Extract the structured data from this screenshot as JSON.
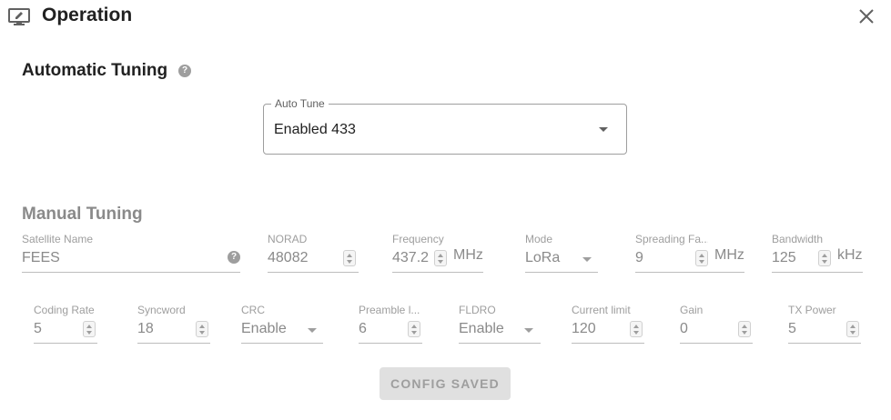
{
  "header": {
    "title": "Operation",
    "icon": "monitor-edit-icon",
    "close_icon": "close-icon"
  },
  "automatic": {
    "title": "Automatic Tuning",
    "help_icon": "help-icon",
    "auto_tune": {
      "label": "Auto Tune",
      "value": "Enabled 433"
    }
  },
  "manual": {
    "title": "Manual Tuning",
    "satellite_name": {
      "label": "Satellite Name",
      "value": "FEES"
    },
    "norad": {
      "label": "NORAD",
      "value": "48082"
    },
    "frequency": {
      "label": "Frequency",
      "value": "437.2",
      "unit": "MHz"
    },
    "mode": {
      "label": "Mode",
      "value": "LoRa"
    },
    "spreading_factor": {
      "label": "Spreading Fa...",
      "value": "9",
      "unit": "MHz"
    },
    "bandwidth": {
      "label": "Bandwidth",
      "value": "125",
      "unit": "kHz"
    },
    "coding_rate": {
      "label": "Coding Rate",
      "value": "5"
    },
    "syncword": {
      "label": "Syncword",
      "value": "18"
    },
    "crc": {
      "label": "CRC",
      "value": "Enable"
    },
    "preamble": {
      "label": "Preamble l...",
      "value": "6"
    },
    "fldro": {
      "label": "FLDRO",
      "value": "Enable"
    },
    "current_limit": {
      "label": "Current limit",
      "value": "120"
    },
    "gain": {
      "label": "Gain",
      "value": "0"
    },
    "tx_power": {
      "label": "TX Power",
      "value": "5"
    }
  },
  "button": {
    "label": "CONFIG SAVED"
  }
}
